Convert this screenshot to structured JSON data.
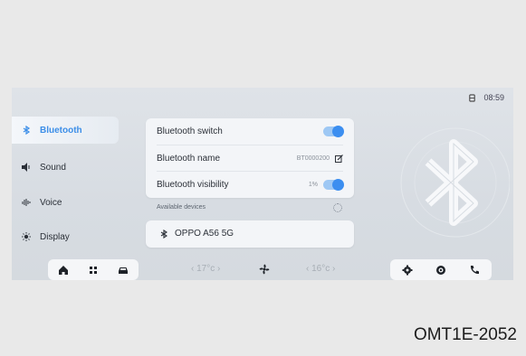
{
  "status": {
    "time": "08:59"
  },
  "sidebar": {
    "items": [
      {
        "label": "Bluetooth",
        "icon": "bluetooth-icon",
        "active": true
      },
      {
        "label": "Sound",
        "icon": "speaker-icon",
        "active": false
      },
      {
        "label": "Voice",
        "icon": "voice-wave-icon",
        "active": false
      },
      {
        "label": "Display",
        "icon": "brightness-icon",
        "active": false
      }
    ]
  },
  "bluetooth": {
    "switch_label": "Bluetooth switch",
    "name_label": "Bluetooth name",
    "name_value": "BT0000200",
    "visibility_label": "Bluetooth visibility",
    "visibility_value": "1%",
    "available_label": "Available devices",
    "devices": [
      {
        "name": "OPPO A56 5G"
      }
    ]
  },
  "dock": {
    "left_temp": "‹ 17°c ›",
    "right_temp": "‹ 16°c ›"
  },
  "colors": {
    "accent": "#3b8ef0",
    "panel": "#f3f5f8"
  },
  "caption": "OMT1E-2052"
}
